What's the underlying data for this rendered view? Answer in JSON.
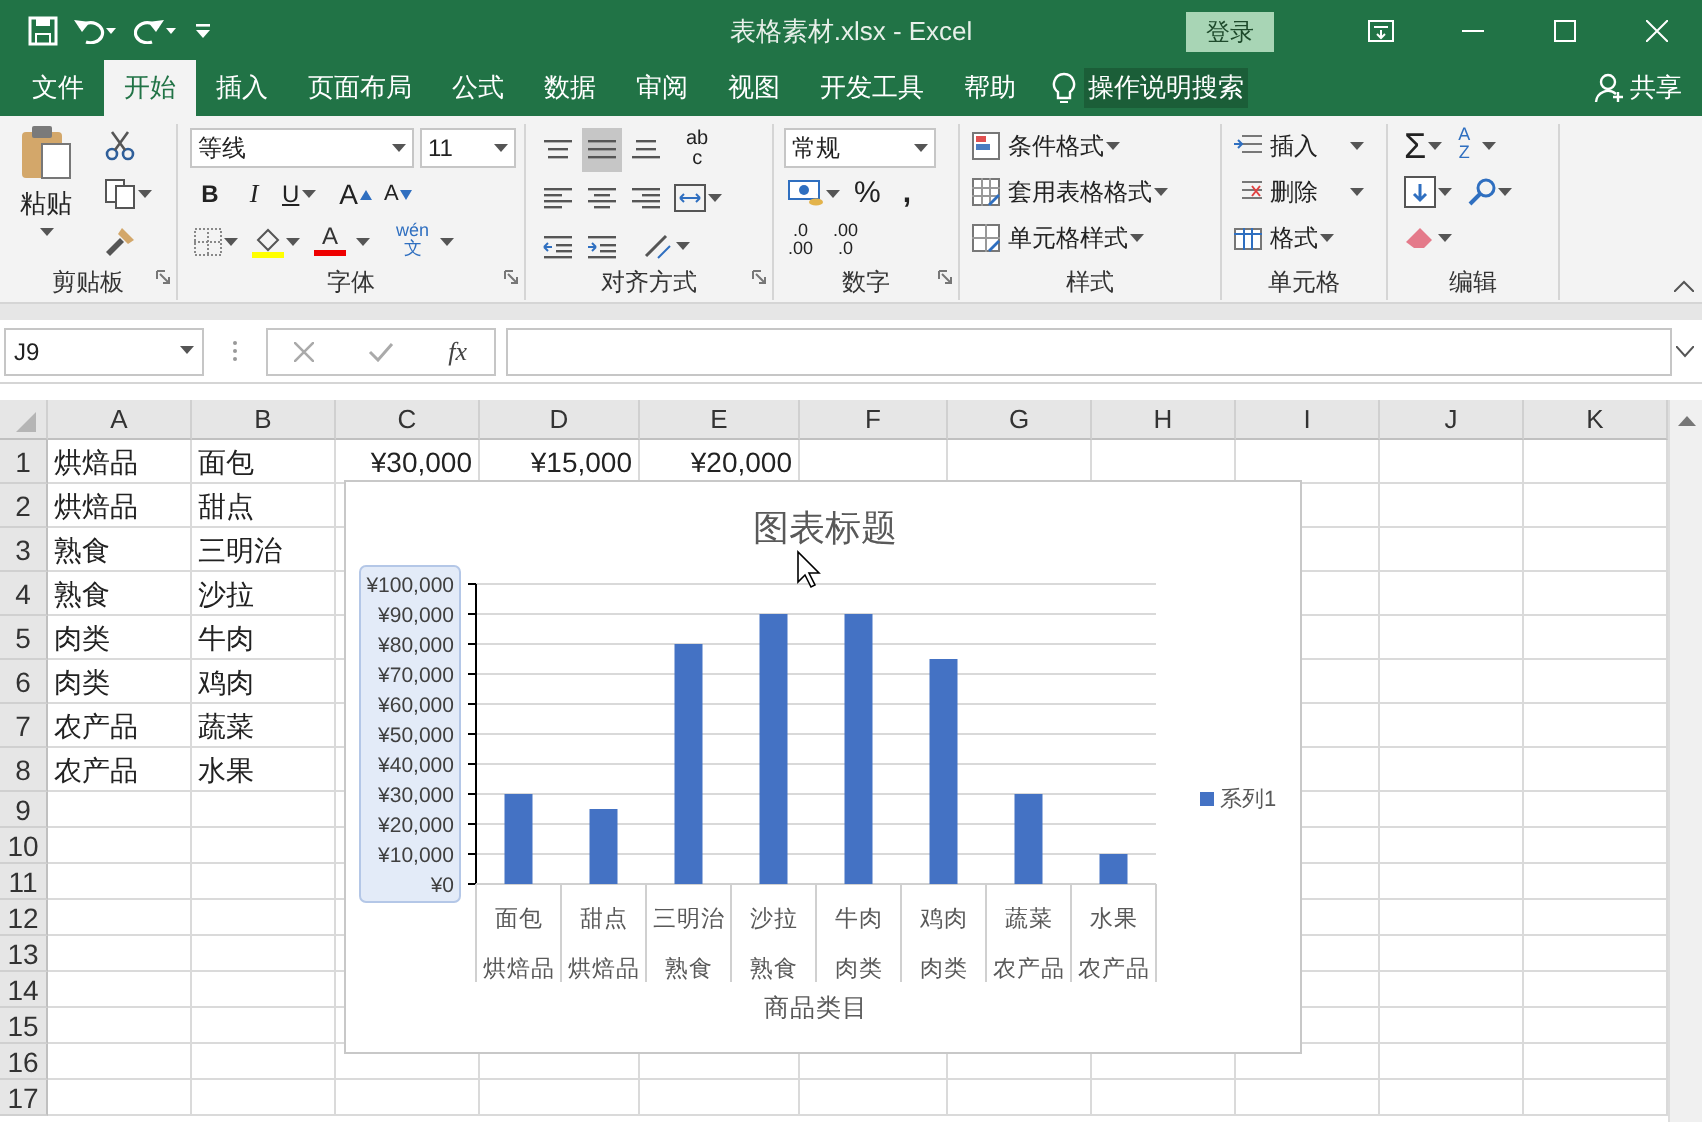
{
  "title_bar": {
    "title": "表格素材.xlsx  -  Excel",
    "login": "登录"
  },
  "ribbon_tabs": [
    {
      "label": "文件",
      "selected": false
    },
    {
      "label": "开始",
      "selected": true
    },
    {
      "label": "插入",
      "selected": false
    },
    {
      "label": "页面布局",
      "selected": false
    },
    {
      "label": "公式",
      "selected": false
    },
    {
      "label": "数据",
      "selected": false
    },
    {
      "label": "审阅",
      "selected": false
    },
    {
      "label": "视图",
      "selected": false
    },
    {
      "label": "开发工具",
      "selected": false
    },
    {
      "label": "帮助",
      "selected": false
    }
  ],
  "tell_me": "操作说明搜索",
  "share": "共享",
  "ribbon": {
    "clipboard": {
      "paste": "粘贴",
      "label": "剪贴板"
    },
    "font": {
      "font_name": "等线",
      "font_size": "11",
      "bold": "B",
      "italic": "I",
      "underline": "U",
      "grow": "A",
      "shrink": "A",
      "font_color": "A",
      "phonetic_top": "wén",
      "phonetic_bottom": "文",
      "label": "字体"
    },
    "alignment": {
      "vertical_align": [
        {
          "selected": false
        },
        {
          "selected": true
        },
        {
          "selected": false
        }
      ],
      "wrap_top": "ab",
      "wrap_bottom": "c",
      "label": "对齐方式"
    },
    "number": {
      "format": "常规",
      "percent": "%",
      "comma": ",",
      "decimals": [
        {
          "top": ".0",
          "bottom": ".00"
        },
        {
          "top": ".00",
          "bottom": ".0"
        }
      ],
      "label": "数字"
    },
    "styles": {
      "items": [
        "条件格式",
        "套用表格格式",
        "单元格样式"
      ],
      "label": "样式"
    },
    "cells": {
      "items": [
        "插入",
        "删除",
        "格式"
      ],
      "label": "单元格"
    },
    "editing": {
      "sum": "Σ",
      "sort_top": "A",
      "sort_bottom": "Z",
      "label": "编辑"
    }
  },
  "formula_bar": {
    "name_box": "J9",
    "fx": "fx"
  },
  "sheet": {
    "columns": [
      "A",
      "B",
      "C",
      "D",
      "E",
      "F",
      "G",
      "H",
      "I",
      "J",
      "K"
    ],
    "row_numbers": [
      "1",
      "2",
      "3",
      "4",
      "5",
      "6",
      "7",
      "8",
      "9",
      "10",
      "11",
      "12",
      "13",
      "14",
      "15",
      "16",
      "17"
    ],
    "rows": [
      {
        "A": "烘焙品",
        "B": "面包",
        "C": "¥30,000",
        "D": "¥15,000",
        "E": "¥20,000"
      },
      {
        "A": "烘焙品",
        "B": "甜点"
      },
      {
        "A": "熟食",
        "B": "三明治"
      },
      {
        "A": "熟食",
        "B": "沙拉"
      },
      {
        "A": "肉类",
        "B": "牛肉"
      },
      {
        "A": "肉类",
        "B": "鸡肉"
      },
      {
        "A": "农产品",
        "B": "蔬菜"
      },
      {
        "A": "农产品",
        "B": "水果"
      }
    ]
  },
  "chart": {
    "group_labels": [
      "烘焙品",
      "烘焙品",
      "熟食",
      "熟食",
      "肉类",
      "肉类",
      "农产品",
      "农产品"
    ],
    "chart_data": {
      "type": "bar",
      "title": "图表标题",
      "xlabel": "商品类目",
      "grid": true,
      "categories": [
        "面包",
        "甜点",
        "三明治",
        "沙拉",
        "牛肉",
        "鸡肉",
        "蔬菜",
        "水果"
      ],
      "series": [
        {
          "name": "系列1",
          "color": "#4472c4",
          "values": [
            30000,
            25000,
            80000,
            90000,
            90000,
            75000,
            30000,
            10000
          ]
        }
      ],
      "ylim": [
        0,
        100000
      ],
      "yticks": [
        {
          "value": 0,
          "label": "¥0"
        },
        {
          "value": 10000,
          "label": "¥10,000"
        },
        {
          "value": 20000,
          "label": "¥20,000"
        },
        {
          "value": 30000,
          "label": "¥30,000"
        },
        {
          "value": 40000,
          "label": "¥40,000"
        },
        {
          "value": 50000,
          "label": "¥50,000"
        },
        {
          "value": 60000,
          "label": "¥60,000"
        },
        {
          "value": 70000,
          "label": "¥70,000"
        },
        {
          "value": 80000,
          "label": "¥80,000"
        },
        {
          "value": 90000,
          "label": "¥90,000"
        },
        {
          "value": 100000,
          "label": "¥100,000"
        }
      ]
    }
  }
}
